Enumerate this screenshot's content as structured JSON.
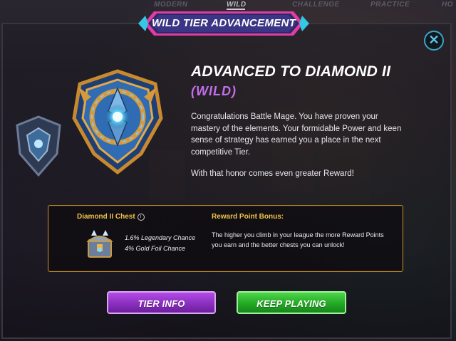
{
  "top_tabs": [
    {
      "label": "MODERN",
      "active": false
    },
    {
      "label": "WILD",
      "active": true
    },
    {
      "label": "CHALLENGE",
      "active": false
    },
    {
      "label": "PRACTICE",
      "active": false
    },
    {
      "label": "HO",
      "active": false
    }
  ],
  "modal": {
    "banner_title": "WILD TIER ADVANCEMENT",
    "close_icon": "close-icon",
    "heading": "ADVANCED TO DIAMOND II",
    "subheading": "(WILD)",
    "message": "Congratulations Battle Mage. You have proven your mastery of the elements. Your formidable Power and keen sense of strategy has earned you a place in the next competitive Tier.",
    "message2": "With that honor comes even greater Reward!"
  },
  "rewards": {
    "chest_title": "Diamond II Chest",
    "chest_info_icon": "info-icon",
    "legendary_chance": "1.6% Legendary Chance",
    "gold_foil_chance": "4% Gold Foil Chance",
    "bonus_title": "Reward Point Bonus:",
    "bonus_text": "The higher you climb in your league the more Reward Points you earn and the better chests you can unlock!"
  },
  "buttons": {
    "tier_info": "TIER INFO",
    "keep_playing": "KEEP PLAYING"
  },
  "colors": {
    "heading": "#ffffff",
    "subheading": "#c26ee8",
    "gold_label": "#f1c24c",
    "panel_border": "#b9872e",
    "tier_button": "#8a2fc0",
    "play_button": "#23a925",
    "close_accent": "#3fa4c4"
  }
}
